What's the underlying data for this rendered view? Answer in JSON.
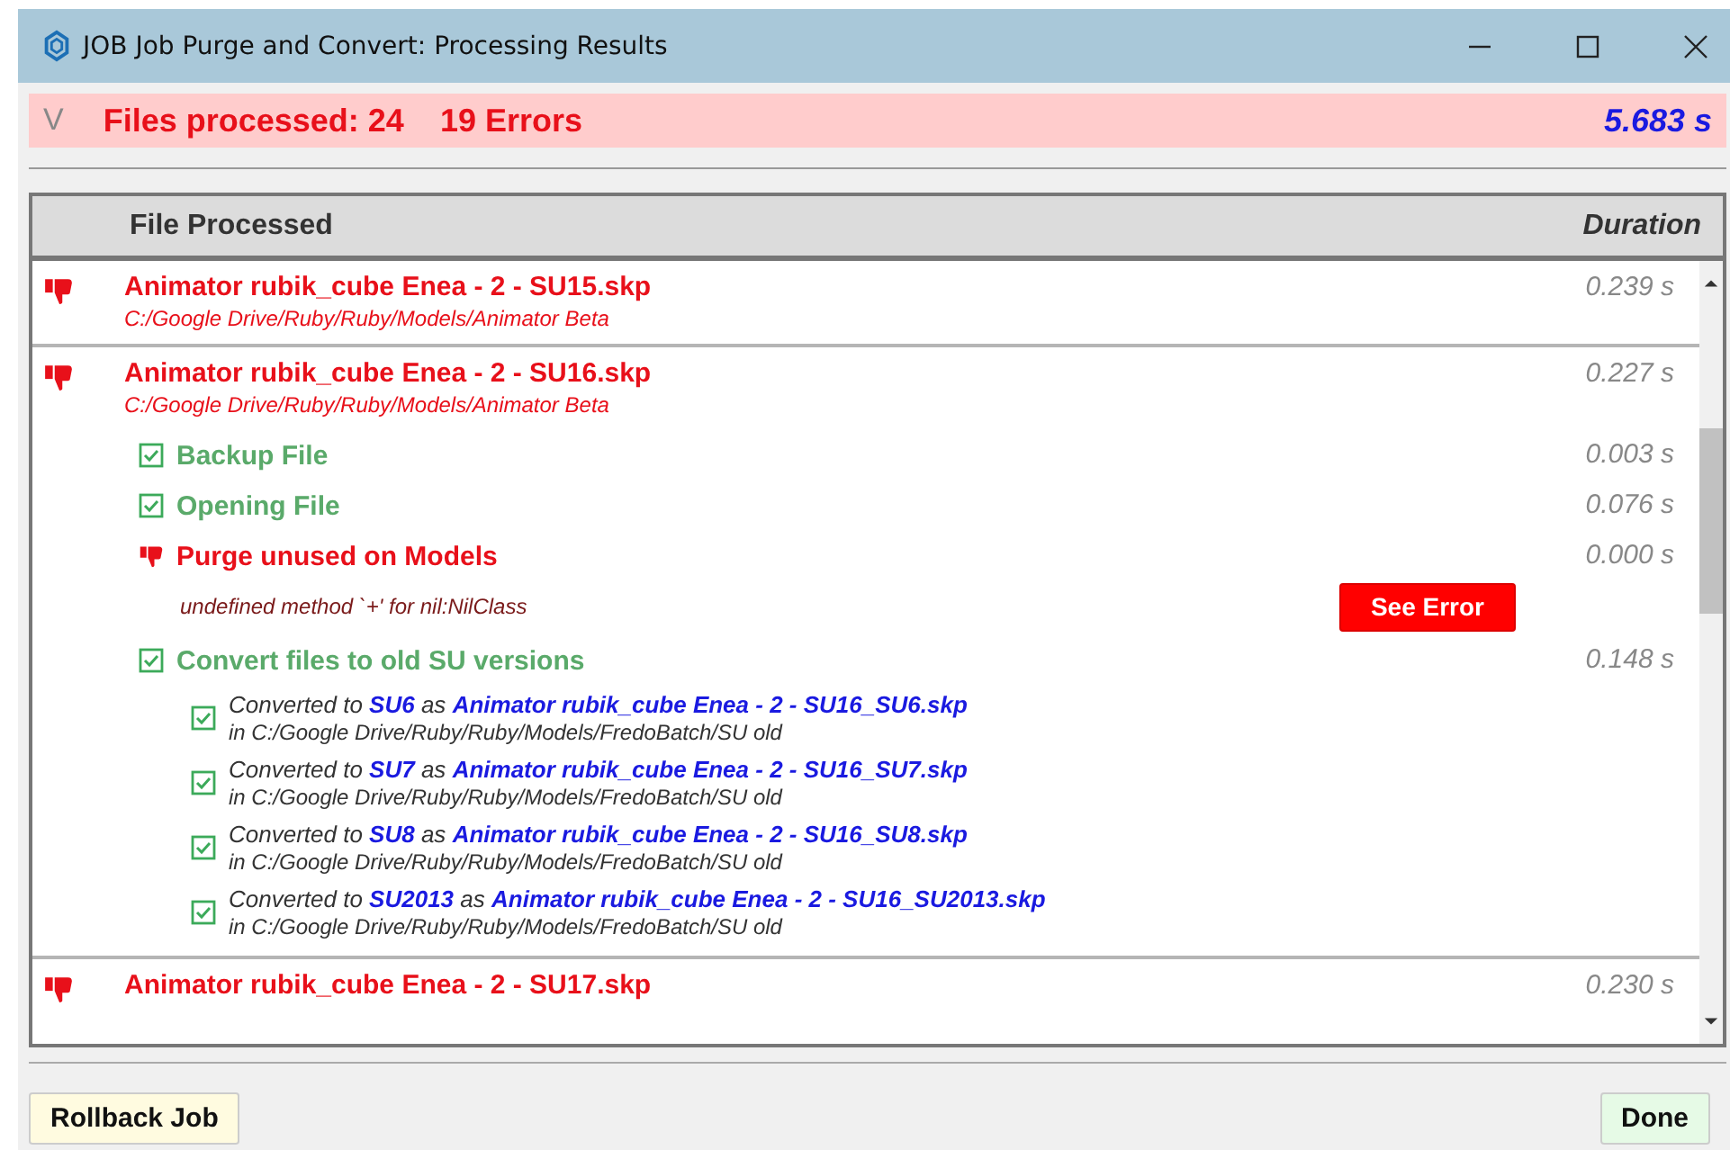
{
  "window": {
    "title": "JOB Job Purge and Convert: Processing Results"
  },
  "summary": {
    "toggle": "V",
    "files_processed": "Files processed: 24",
    "errors": "19 Errors",
    "total_duration": "5.683 s"
  },
  "table": {
    "columns": [
      "File Processed",
      "Duration"
    ],
    "files": [
      {
        "kind": "error",
        "name": "Animator rubik_cube Enea - 2 - SU15.skp",
        "path": "C:/Google Drive/Ruby/Ruby/Models/Animator Beta",
        "duration": "0.239 s"
      },
      {
        "kind": "error",
        "name": "Animator rubik_cube Enea - 2 - SU16.skp",
        "path": "C:/Google Drive/Ruby/Ruby/Models/Animator Beta",
        "duration": "0.227 s",
        "steps": [
          {
            "kind": "ok",
            "label": "Backup File",
            "duration": "0.003 s"
          },
          {
            "kind": "ok",
            "label": "Opening File",
            "duration": "0.076 s"
          },
          {
            "kind": "error",
            "label": "Purge unused on Models",
            "duration": "0.000 s",
            "error": "undefined method `+' for nil:NilClass",
            "error_button": "See Error"
          },
          {
            "kind": "ok",
            "label": "Convert files to old SU versions",
            "duration": "0.148 s",
            "conversions": [
              {
                "kind": "ok",
                "prefix": "Converted to",
                "version": "SU6",
                "middle": "as",
                "file": "Animator rubik_cube Enea - 2 - SU16_SU6.skp",
                "folder": "in C:/Google Drive/Ruby/Ruby/Models/FredoBatch/SU old"
              },
              {
                "kind": "ok",
                "prefix": "Converted to",
                "version": "SU7",
                "middle": "as",
                "file": "Animator rubik_cube Enea - 2 - SU16_SU7.skp",
                "folder": "in C:/Google Drive/Ruby/Ruby/Models/FredoBatch/SU old"
              },
              {
                "kind": "ok",
                "prefix": "Converted to",
                "version": "SU8",
                "middle": "as",
                "file": "Animator rubik_cube Enea - 2 - SU16_SU8.skp",
                "folder": "in C:/Google Drive/Ruby/Ruby/Models/FredoBatch/SU old"
              },
              {
                "kind": "ok",
                "prefix": "Converted to",
                "version": "SU2013",
                "middle": "as",
                "file": "Animator rubik_cube Enea - 2 - SU16_SU2013.skp",
                "folder": "in C:/Google Drive/Ruby/Ruby/Models/FredoBatch/SU old"
              }
            ]
          }
        ]
      },
      {
        "kind": "error",
        "name": "Animator rubik_cube Enea - 2 - SU17.skp",
        "duration": "0.230 s"
      }
    ]
  },
  "buttons": {
    "left": "Rollback Job",
    "right": "Done"
  }
}
